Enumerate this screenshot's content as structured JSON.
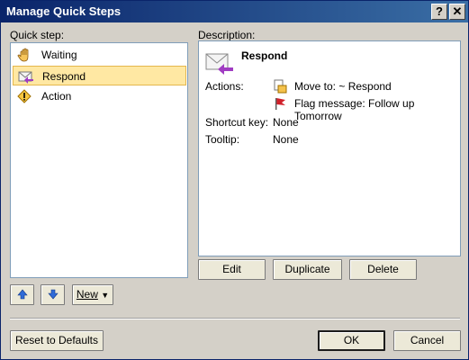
{
  "window": {
    "title": "Manage Quick Steps",
    "help_glyph": "?",
    "close_glyph": "✕"
  },
  "left": {
    "label": "Quick step:",
    "items": [
      {
        "label": "Waiting",
        "icon": "hand-icon",
        "selected": false
      },
      {
        "label": "Respond",
        "icon": "envelope-reply-icon",
        "selected": true
      },
      {
        "label": "Action",
        "icon": "warning-icon",
        "selected": false
      }
    ],
    "new_label": "New"
  },
  "description": {
    "label": "Description:",
    "title": "Respond",
    "actions_label": "Actions:",
    "actions": [
      {
        "text": "Move to: ~ Respond",
        "icon": "move-to-folder-icon"
      },
      {
        "text": "Flag message: Follow up Tomorrow",
        "icon": "red-flag-icon"
      }
    ],
    "shortcut_label": "Shortcut key:",
    "shortcut_value": "None",
    "tooltip_label": "Tooltip:",
    "tooltip_value": "None"
  },
  "buttons": {
    "edit": "Edit",
    "duplicate": "Duplicate",
    "delete": "Delete",
    "reset": "Reset to Defaults",
    "ok": "OK",
    "cancel": "Cancel"
  },
  "colors": {
    "title_bar": "#0a246a",
    "selection": "#ffe8a3",
    "dialog": "#d4d0c8"
  }
}
